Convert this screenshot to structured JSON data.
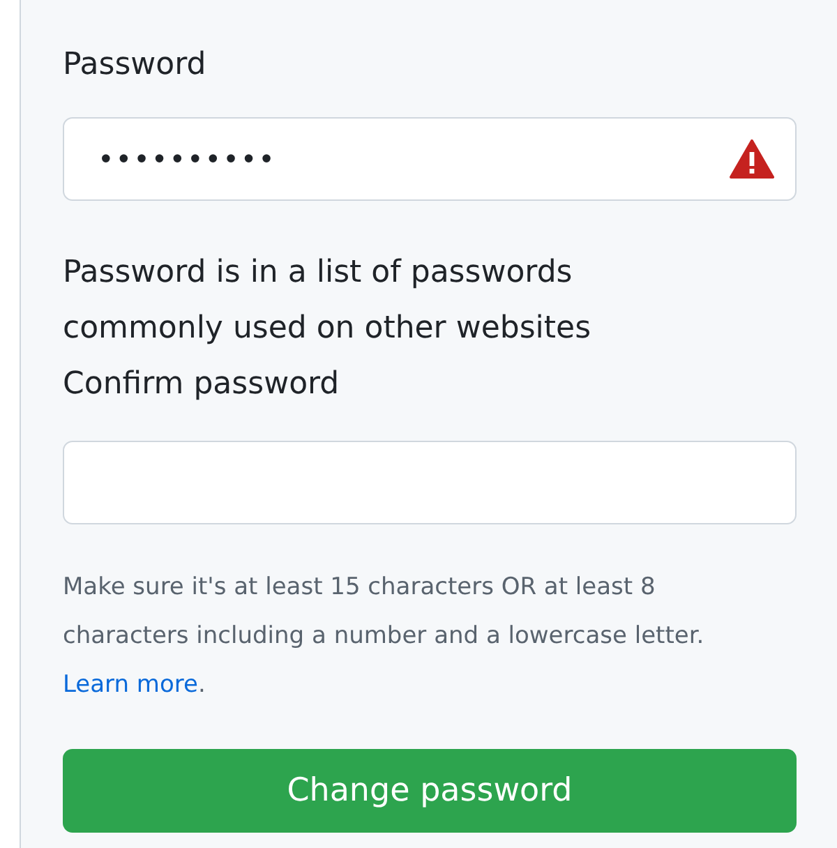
{
  "password": {
    "label": "Password",
    "value": "••••••••••",
    "invalid": true,
    "error": "Password is in a list of passwords commonly used on other websites"
  },
  "confirm_password": {
    "label": "Confirm password"
  },
  "hint": {
    "text": "Make sure it's at least 15 characters OR at least 8 characters including a number and a lowercase letter.",
    "link": "Learn more",
    "after_link": "."
  },
  "button": {
    "label": "Change password"
  }
}
